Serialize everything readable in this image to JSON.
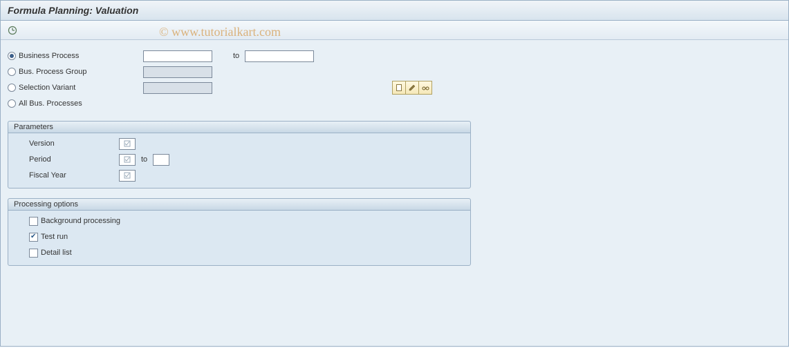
{
  "title": "Formula Planning: Valuation",
  "watermark": "© www.tutorialkart.com",
  "toolbar": {
    "execute_icon": "execute"
  },
  "selection": {
    "options": [
      {
        "label": "Business Process",
        "selected": true,
        "has_range": true,
        "from": "",
        "to_label": "to",
        "to": "",
        "disabled": false
      },
      {
        "label": "Bus. Process Group",
        "selected": false,
        "has_range": false,
        "from": "",
        "disabled": true
      },
      {
        "label": "Selection Variant",
        "selected": false,
        "has_range": false,
        "from": "",
        "disabled": true,
        "variant_buttons": true
      },
      {
        "label": "All Bus. Processes",
        "selected": false,
        "has_range": false
      }
    ]
  },
  "parameters": {
    "title": "Parameters",
    "fields": [
      {
        "label": "Version",
        "value": "",
        "required": true
      },
      {
        "label": "Period",
        "value": "",
        "required": true,
        "has_range": true,
        "to_label": "to",
        "to": ""
      },
      {
        "label": "Fiscal Year",
        "value": "",
        "required": true
      }
    ]
  },
  "processing": {
    "title": "Processing options",
    "options": [
      {
        "label": "Background processing",
        "checked": false
      },
      {
        "label": "Test run",
        "checked": true
      },
      {
        "label": "Detail list",
        "checked": false
      }
    ]
  }
}
